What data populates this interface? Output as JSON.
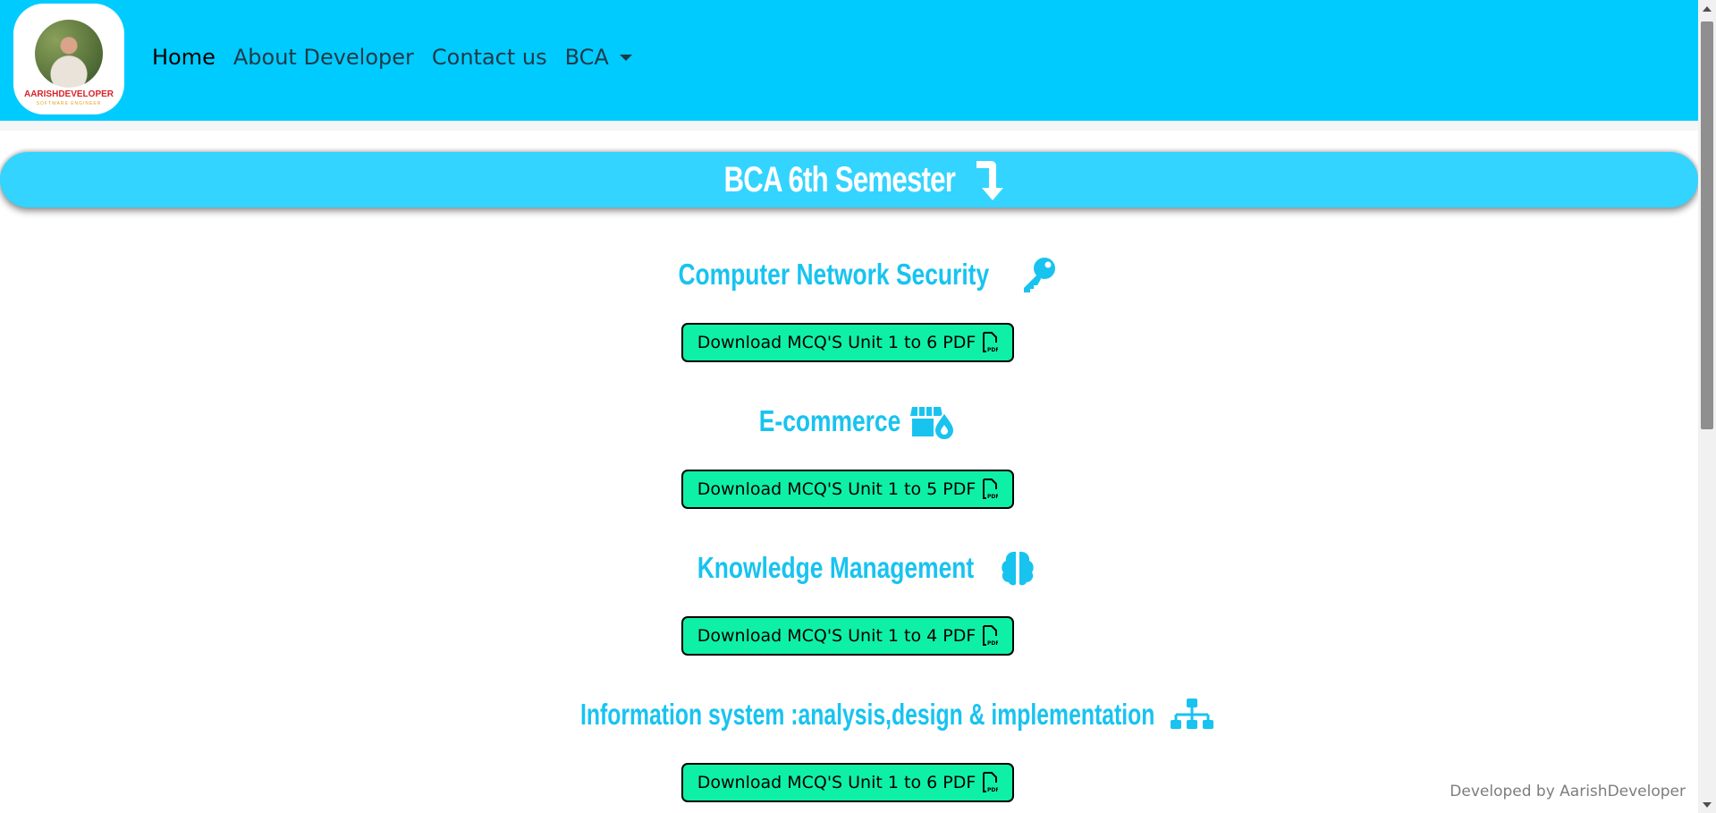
{
  "navbar": {
    "logo": {
      "name": "AARISHDEVELOPER",
      "tagline": "SOFTWARE ENGINEER"
    },
    "links": [
      "Home",
      "About Developer",
      "Contact us"
    ],
    "dropdown_label": "BCA"
  },
  "banner": {
    "title": "BCA 6th Semester",
    "icon": "arrow-turn-down-icon"
  },
  "subjects": [
    {
      "title": "Computer Network Security",
      "icon": "key-icon",
      "button": "Download MCQ'S Unit 1 to 6 PDF"
    },
    {
      "title": "E-commerce",
      "icon": "store-drop-icon",
      "button": "Download MCQ'S Unit 1 to 5 PDF"
    },
    {
      "title": "Knowledge Management",
      "icon": "brain-icon",
      "button": "Download MCQ'S Unit 1 to 4 PDF"
    },
    {
      "title": "Information system :analysis,design & implementation",
      "icon": "sitemap-icon",
      "button": "Download MCQ'S Unit 1 to 6 PDF"
    }
  ],
  "pdf_icon": "file-pdf-icon",
  "footer": "Developed by AarishDeveloper",
  "colors": {
    "navbar": "#00cbff",
    "banner": "#33d4ff",
    "subject_title": "#18c3f0",
    "button": "#0ef0a6"
  }
}
